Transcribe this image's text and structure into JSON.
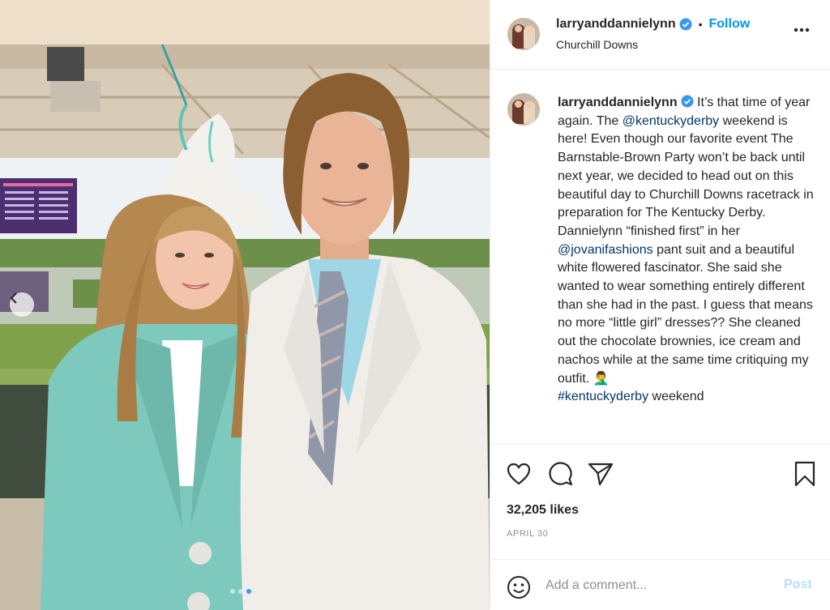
{
  "post": {
    "username": "larryanddannielynn",
    "follow_label": "Follow",
    "separator": "•",
    "location": "Churchill Downs",
    "caption_parts": [
      "It’s that time of year again. The ",
      "@kentuckyderby",
      " weekend is here! Even though our favorite event The Barnstable-Brown Party won’t be back until next year, we decided to head out on this beautiful day to Churchill Downs racetrack in preparation for The Kentucky Derby. Dannielynn “finished first” in her ",
      "@jovanifashions",
      " pant suit and a beautiful white flowered fascinator. She said she wanted to wear something entirely different than she had in the past. I guess that means no more “little girl” dresses?? She cleaned out the chocolate brownies, ice cream and nachos while at the same time critiquing my outfit. ",
      "🤦‍♂️",
      "#kentuckyderby",
      " weekend"
    ],
    "likes": "32,205 likes",
    "date": "APRIL 30"
  },
  "carousel": {
    "total": 3,
    "active_index": 2
  },
  "comment": {
    "placeholder": "Add a comment...",
    "post_label": "Post"
  },
  "colors": {
    "link": "#00376b",
    "follow": "#0095f6",
    "verified": "#3897f0",
    "post_disabled": "#b2dffc"
  },
  "icons": {
    "verified": "verified-badge-icon",
    "more": "more-options-icon",
    "like": "heart-icon",
    "comment": "comment-bubble-icon",
    "share": "paper-plane-icon",
    "save": "bookmark-icon",
    "emoji": "smiley-face-icon",
    "prev": "chevron-left-icon"
  }
}
